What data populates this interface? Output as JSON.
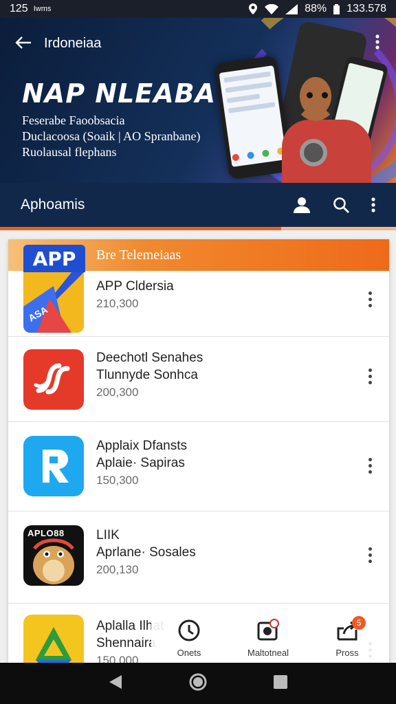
{
  "status": {
    "time": "125",
    "carrier": "Iwms",
    "battery": "88%",
    "clock": "133.578"
  },
  "hero": {
    "country": "Irdoneiaa",
    "title": "NAP NLEABA",
    "sub1": "Feserabe Faoobsacia",
    "sub2": "Duclacoosa (Soaik | AO Spranbane)",
    "sub3": "Ruolausal flephans"
  },
  "appbar": {
    "title": "Aphoamis"
  },
  "progress": {
    "value": 0.71
  },
  "featured": {
    "badge": "APP",
    "label": "Bre Telemeiaas"
  },
  "apps": [
    {
      "line1": "APP Cldersia",
      "line2": "",
      "line3": "210,300",
      "color": "#f2b81e"
    },
    {
      "line1": "Deechotl Senahes",
      "line2": "Tlunnyde Sonhca",
      "line3": "200,300",
      "color": "#e53a2a"
    },
    {
      "line1": "Applaix Dfansts",
      "line2": "Aplaie· Sapiras",
      "line3": "150,300",
      "color": "#1ea8f0"
    },
    {
      "line1": "LIIK",
      "line2": "Aprlane· Sosales",
      "line3": "200,130",
      "color": "#111111"
    },
    {
      "line1": "Aplalla Ilhat",
      "line2": "Shennaira",
      "line3": "150,000",
      "color": "#f4c51e"
    }
  ],
  "icon_label_4": "APLO88",
  "tabs": [
    {
      "label": "Onets",
      "icon": "clock-icon"
    },
    {
      "label": "Maltotneal",
      "icon": "inbox-icon"
    },
    {
      "label": "Pross",
      "icon": "share-icon",
      "badge": "5"
    }
  ]
}
